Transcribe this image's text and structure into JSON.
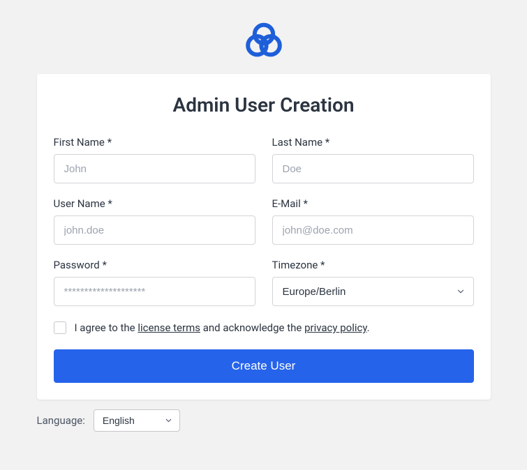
{
  "title": "Admin User Creation",
  "fields": {
    "first_name": {
      "label": "First Name *",
      "placeholder": "John"
    },
    "last_name": {
      "label": "Last Name *",
      "placeholder": "Doe"
    },
    "user_name": {
      "label": "User Name *",
      "placeholder": "john.doe"
    },
    "email": {
      "label": "E-Mail *",
      "placeholder": "john@doe.com"
    },
    "password": {
      "label": "Password *",
      "placeholder": "********************"
    },
    "timezone": {
      "label": "Timezone *",
      "value": "Europe/Berlin"
    }
  },
  "consent": {
    "prefix": "I agree to the ",
    "license_link": "license terms",
    "middle": " and acknowledge the ",
    "privacy_link": "privacy policy",
    "suffix": "."
  },
  "submit_label": "Create User",
  "language": {
    "label": "Language:",
    "value": "English"
  }
}
